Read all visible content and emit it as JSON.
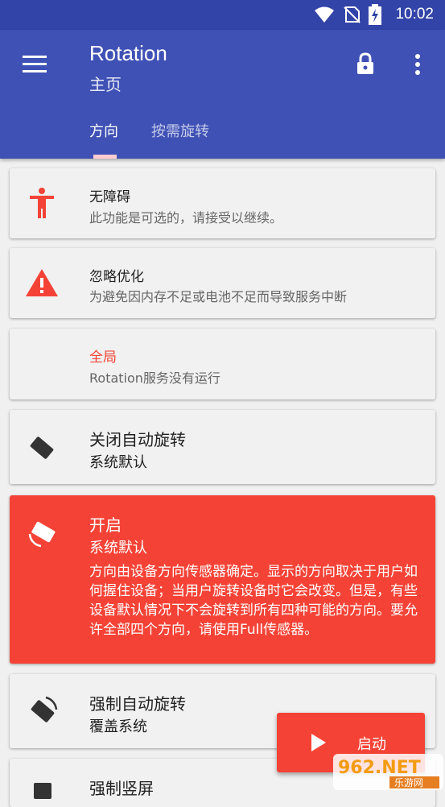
{
  "status_bar": {
    "time": "10:02"
  },
  "app_bar": {
    "title": "Rotation",
    "subtitle": "主页"
  },
  "tabs": [
    {
      "label": "方向"
    },
    {
      "label": "按需旋转"
    }
  ],
  "cards": [
    {
      "title": "无障碍",
      "subtitle": "此功能是可选的，请接受以继续。",
      "icon": "accessibility-icon"
    },
    {
      "title": "忽略优化",
      "subtitle": "为避免因内存不足或电池不足而导致服务中断",
      "icon": "warning-icon"
    },
    {
      "title": "全局",
      "subtitle": "Rotation服务没有运行"
    },
    {
      "title": "关闭自动旋转",
      "subtitle": "系统默认",
      "icon": "rotation-off-icon"
    },
    {
      "title": "开启",
      "subtitle": "系统默认",
      "description": "方向由设备方向传感器确定。显示的方向取决于用户如何握住设备；当用户旋转设备时它会改变。但是，有些设备默认情况下不会旋转到所有四种可能的方向。要允许全部四个方向，请使用Full传感器。",
      "icon": "auto-rotate-icon"
    },
    {
      "title": "强制自动旋转",
      "subtitle": "覆盖系统",
      "icon": "force-rotate-icon"
    },
    {
      "title": "强制竖屏",
      "icon": "portrait-icon"
    }
  ],
  "fab": {
    "label": "启动",
    "icon": "play-icon"
  },
  "watermark": {
    "brand": "962.NET",
    "sub": "乐游网"
  },
  "colors": {
    "primary": "#3f51b5",
    "accent": "#f44336"
  }
}
